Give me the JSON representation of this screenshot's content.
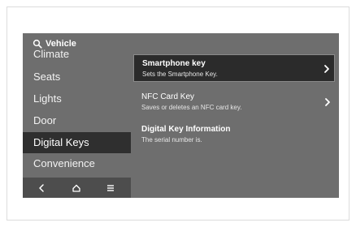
{
  "header": {
    "title": "Vehicle",
    "icon": "search-icon"
  },
  "sidebar": {
    "items": [
      {
        "label": "Climate",
        "selected": false
      },
      {
        "label": "Seats",
        "selected": false
      },
      {
        "label": "Lights",
        "selected": false
      },
      {
        "label": "Door",
        "selected": false
      },
      {
        "label": "Digital Keys",
        "selected": true
      },
      {
        "label": "Convenience",
        "selected": false
      }
    ]
  },
  "bottom_bar": {
    "icons": [
      "back-icon",
      "home-icon",
      "menu-icon"
    ]
  },
  "main": {
    "items": [
      {
        "title": "Smartphone key",
        "subtitle": "Sets the Smartphone Key.",
        "has_arrow": true,
        "highlighted": true
      },
      {
        "title": "NFC Card Key",
        "subtitle": "Saves or deletes an NFC card key.",
        "has_arrow": true,
        "highlighted": false
      },
      {
        "title": "Digital Key Information",
        "subtitle": "The serial number is.",
        "has_arrow": false,
        "highlighted": false
      }
    ]
  },
  "colors": {
    "screen_bg": "#6e6e6e",
    "selected_bg": "#2f2f2f",
    "highlight_bg": "#2b2b2b",
    "text": "#ffffff"
  }
}
